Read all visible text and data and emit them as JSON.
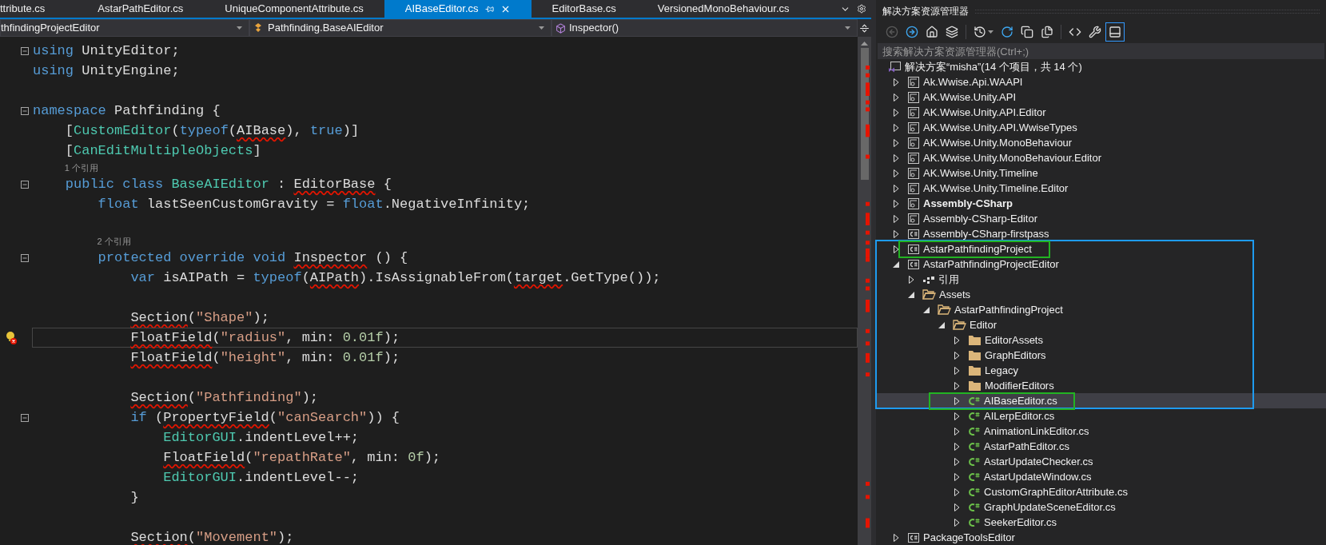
{
  "tabs": [
    {
      "label": "ttribute.cs",
      "selected": false
    },
    {
      "label": "AstarPathEditor.cs",
      "selected": false
    },
    {
      "label": "UniqueComponentAttribute.cs",
      "selected": false
    },
    {
      "label": "AIBaseEditor.cs",
      "selected": true
    },
    {
      "label": "EditorBase.cs",
      "selected": false
    },
    {
      "label": "VersionedMonoBehaviour.cs",
      "selected": false
    }
  ],
  "nav": {
    "project": "thfindingProjectEditor",
    "type": "Pathfinding.BaseAIEditor",
    "member": "Inspector()"
  },
  "editor": {
    "lines": [
      {
        "kind": "code",
        "fold": true,
        "current": false,
        "tokens": [
          {
            "text": "using",
            "kind": "kw"
          },
          {
            "text": " UnityEditor;",
            "kind": "txt"
          }
        ]
      },
      {
        "kind": "code",
        "fold": false,
        "current": false,
        "tokens": [
          {
            "text": "using",
            "kind": "kw"
          },
          {
            "text": " UnityEngine;",
            "kind": "txt"
          }
        ]
      },
      {
        "kind": "blank"
      },
      {
        "kind": "code",
        "fold": true,
        "current": false,
        "tokens": [
          {
            "text": "namespace",
            "kind": "kw"
          },
          {
            "text": " Pathfinding {",
            "kind": "txt"
          }
        ],
        "children": [
          {
            "kind": "code",
            "fold": false,
            "current": false,
            "tokens": [
              {
                "text": "[",
                "kind": "txt"
              },
              {
                "text": "CustomEditor",
                "kind": "type"
              },
              {
                "text": "(",
                "kind": "txt"
              },
              {
                "text": "typeof",
                "kind": "kw"
              },
              {
                "text": "(",
                "kind": "txt"
              },
              {
                "text": "AIBase",
                "kind": "err"
              },
              {
                "text": "), ",
                "kind": "txt"
              },
              {
                "text": "true",
                "kind": "kw"
              },
              {
                "text": ")]",
                "kind": "txt"
              }
            ]
          },
          {
            "kind": "code",
            "fold": false,
            "current": false,
            "tokens": [
              {
                "text": "[",
                "kind": "txt"
              },
              {
                "text": "CanEditMultipleObjects",
                "kind": "type"
              },
              {
                "text": "]",
                "kind": "txt"
              }
            ]
          },
          {
            "kind": "lens",
            "text": "1 个引用"
          },
          {
            "kind": "code",
            "fold": true,
            "current": false,
            "tokens": [
              {
                "text": "public class",
                "kind": "kw"
              },
              {
                "text": " BaseAIEditor",
                "kind": "type"
              },
              {
                "text": " : ",
                "kind": "txt"
              },
              {
                "text": "EditorBase",
                "kind": "err"
              },
              {
                "text": " {",
                "kind": "txt"
              }
            ],
            "children": [
              {
                "kind": "code",
                "fold": false,
                "current": false,
                "tokens": [
                  {
                    "text": "float",
                    "kind": "kw"
                  },
                  {
                    "text": " lastSeenCustomGravity = ",
                    "kind": "txt"
                  },
                  {
                    "text": "float",
                    "kind": "kw"
                  },
                  {
                    "text": ".NegativeInfinity;",
                    "kind": "txt"
                  }
                ]
              },
              {
                "kind": "blank"
              },
              {
                "kind": "lens",
                "text": "2 个引用"
              },
              {
                "kind": "code",
                "fold": true,
                "current": false,
                "tokens": [
                  {
                    "text": "protected override void ",
                    "kind": "kw"
                  },
                  {
                    "text": "Inspector",
                    "kind": "err"
                  },
                  {
                    "text": " () {",
                    "kind": "txt"
                  }
                ],
                "children": [
                  {
                    "kind": "code",
                    "fold": false,
                    "current": false,
                    "tokens": [
                      {
                        "text": "var",
                        "kind": "kw"
                      },
                      {
                        "text": " isAIPath = ",
                        "kind": "txt"
                      },
                      {
                        "text": "typeof",
                        "kind": "kw"
                      },
                      {
                        "text": "(",
                        "kind": "txt"
                      },
                      {
                        "text": "AIPath",
                        "kind": "err"
                      },
                      {
                        "text": ").IsAssignableFrom(",
                        "kind": "txt"
                      },
                      {
                        "text": "target",
                        "kind": "err"
                      },
                      {
                        "text": ".GetType());",
                        "kind": "txt"
                      }
                    ]
                  },
                  {
                    "kind": "blank"
                  },
                  {
                    "kind": "code",
                    "fold": false,
                    "current": false,
                    "tokens": [
                      {
                        "text": "Section",
                        "kind": "err"
                      },
                      {
                        "text": "(",
                        "kind": "txt"
                      },
                      {
                        "text": "\"Shape\"",
                        "kind": "str"
                      },
                      {
                        "text": ");",
                        "kind": "txt"
                      }
                    ]
                  },
                  {
                    "kind": "code",
                    "fold": false,
                    "current": true,
                    "lightbulb": true,
                    "tokens": [
                      {
                        "text": "FloatField",
                        "kind": "err"
                      },
                      {
                        "text": "(",
                        "kind": "txt"
                      },
                      {
                        "text": "\"radius\"",
                        "kind": "str"
                      },
                      {
                        "text": ", min: ",
                        "kind": "txt"
                      },
                      {
                        "text": "0.01f",
                        "kind": "num"
                      },
                      {
                        "text": ");",
                        "kind": "txt"
                      }
                    ]
                  },
                  {
                    "kind": "code",
                    "fold": false,
                    "current": false,
                    "tokens": [
                      {
                        "text": "FloatField",
                        "kind": "err"
                      },
                      {
                        "text": "(",
                        "kind": "txt"
                      },
                      {
                        "text": "\"height\"",
                        "kind": "str"
                      },
                      {
                        "text": ", min: ",
                        "kind": "txt"
                      },
                      {
                        "text": "0.01f",
                        "kind": "num"
                      },
                      {
                        "text": ");",
                        "kind": "txt"
                      }
                    ]
                  },
                  {
                    "kind": "blank"
                  },
                  {
                    "kind": "code",
                    "fold": false,
                    "current": false,
                    "tokens": [
                      {
                        "text": "Section",
                        "kind": "err"
                      },
                      {
                        "text": "(",
                        "kind": "txt"
                      },
                      {
                        "text": "\"Pathfinding\"",
                        "kind": "str"
                      },
                      {
                        "text": ");",
                        "kind": "txt"
                      }
                    ]
                  },
                  {
                    "kind": "code",
                    "fold": true,
                    "current": false,
                    "tokens": [
                      {
                        "text": "if",
                        "kind": "kw"
                      },
                      {
                        "text": " (",
                        "kind": "txt"
                      },
                      {
                        "text": "PropertyField",
                        "kind": "err"
                      },
                      {
                        "text": "(",
                        "kind": "txt"
                      },
                      {
                        "text": "\"canSearch\"",
                        "kind": "str"
                      },
                      {
                        "text": ")) {",
                        "kind": "txt"
                      }
                    ],
                    "children": [
                      {
                        "kind": "code",
                        "fold": false,
                        "current": false,
                        "tokens": [
                          {
                            "text": "EditorGUI",
                            "kind": "type"
                          },
                          {
                            "text": ".indentLevel++;",
                            "kind": "txt"
                          }
                        ]
                      },
                      {
                        "kind": "code",
                        "fold": false,
                        "current": false,
                        "tokens": [
                          {
                            "text": "FloatField",
                            "kind": "err"
                          },
                          {
                            "text": "(",
                            "kind": "txt"
                          },
                          {
                            "text": "\"repathRate\"",
                            "kind": "str"
                          },
                          {
                            "text": ", min: ",
                            "kind": "txt"
                          },
                          {
                            "text": "0f",
                            "kind": "num"
                          },
                          {
                            "text": ");",
                            "kind": "txt"
                          }
                        ]
                      },
                      {
                        "kind": "code",
                        "fold": false,
                        "current": false,
                        "tokens": [
                          {
                            "text": "EditorGUI",
                            "kind": "type"
                          },
                          {
                            "text": ".indentLevel--;",
                            "kind": "txt"
                          }
                        ]
                      }
                    ]
                  },
                  {
                    "kind": "code",
                    "fold": false,
                    "current": false,
                    "tokens": [
                      {
                        "text": "}",
                        "kind": "txt"
                      }
                    ]
                  },
                  {
                    "kind": "blank"
                  },
                  {
                    "kind": "code",
                    "fold": false,
                    "current": false,
                    "tokens": [
                      {
                        "text": "Section",
                        "kind": "err"
                      },
                      {
                        "text": "(",
                        "kind": "txt"
                      },
                      {
                        "text": "\"Movement\"",
                        "kind": "str"
                      },
                      {
                        "text": ");",
                        "kind": "txt"
                      }
                    ]
                  }
                ]
              }
            ]
          }
        ]
      }
    ]
  },
  "explorer": {
    "title": "解决方案资源管理器",
    "toolbar": [
      [
        {
          "kind": "back",
          "disabled": true,
          "pressed": false
        },
        {
          "kind": "forward",
          "disabled": false,
          "pressed": false
        },
        {
          "kind": "home",
          "disabled": false,
          "pressed": false
        },
        {
          "kind": "switch_views",
          "disabled": false,
          "pressed": false
        }
      ],
      [
        {
          "kind": "history",
          "disabled": false,
          "pressed": false
        },
        {
          "kind": "refresh",
          "disabled": false,
          "pressed": false
        },
        {
          "kind": "collapse_all",
          "disabled": false,
          "pressed": false
        },
        {
          "kind": "show_all_files",
          "disabled": false,
          "pressed": false
        }
      ],
      [
        {
          "kind": "view_code",
          "disabled": false,
          "pressed": false
        },
        {
          "kind": "properties",
          "disabled": false,
          "pressed": false
        },
        {
          "kind": "preview",
          "disabled": false,
          "pressed": true
        }
      ]
    ],
    "search": {
      "placeholder": "搜索解决方案资源管理器(Ctrl+;)"
    },
    "solution": {
      "label": "解决方案“misha”(14 个项目，共 14 个)",
      "items": [
        {
          "label": "Ak.Wwise.Api.WAAPI",
          "kind": "project",
          "startup": false,
          "expanded": false,
          "selected": false
        },
        {
          "label": "AK.Wwise.Unity.API",
          "kind": "project",
          "startup": false,
          "expanded": false,
          "selected": false
        },
        {
          "label": "AK.Wwise.Unity.API.Editor",
          "kind": "project",
          "startup": false,
          "expanded": false,
          "selected": false
        },
        {
          "label": "AK.Wwise.Unity.API.WwiseTypes",
          "kind": "project",
          "startup": false,
          "expanded": false,
          "selected": false
        },
        {
          "label": "AK.Wwise.Unity.MonoBehaviour",
          "kind": "project",
          "startup": false,
          "expanded": false,
          "selected": false
        },
        {
          "label": "AK.Wwise.Unity.MonoBehaviour.Editor",
          "kind": "project",
          "startup": false,
          "expanded": false,
          "selected": false
        },
        {
          "label": "AK.Wwise.Unity.Timeline",
          "kind": "project",
          "startup": false,
          "expanded": false,
          "selected": false
        },
        {
          "label": "AK.Wwise.Unity.Timeline.Editor",
          "kind": "project",
          "startup": false,
          "expanded": false,
          "selected": false
        },
        {
          "label": "Assembly-CSharp",
          "kind": "project",
          "startup": true,
          "expanded": false,
          "selected": false
        },
        {
          "label": "Assembly-CSharp-Editor",
          "kind": "project",
          "startup": false,
          "expanded": false,
          "selected": false
        },
        {
          "label": "Assembly-CSharp-firstpass",
          "kind": "csproject",
          "startup": false,
          "expanded": false,
          "selected": false
        },
        {
          "label": "AstarPathfindingProject",
          "kind": "csproject",
          "startup": false,
          "expanded": false,
          "selected": false
        },
        {
          "label": "AstarPathfindingProjectEditor",
          "kind": "csproject",
          "startup": false,
          "expanded": true,
          "selected": false,
          "children": [
            {
              "label": "引用",
              "kind": "references",
              "expanded": false,
              "selected": false
            },
            {
              "label": "Assets",
              "kind": "folder",
              "expanded": true,
              "selected": false,
              "children": [
                {
                  "label": "AstarPathfindingProject",
                  "kind": "folder",
                  "expanded": true,
                  "selected": false,
                  "children": [
                    {
                      "label": "Editor",
                      "kind": "folder",
                      "expanded": true,
                      "selected": false,
                      "children": [
                        {
                          "label": "EditorAssets",
                          "kind": "folder",
                          "expanded": false,
                          "selected": false
                        },
                        {
                          "label": "GraphEditors",
                          "kind": "folder",
                          "expanded": false,
                          "selected": false
                        },
                        {
                          "label": "Legacy",
                          "kind": "folder",
                          "expanded": false,
                          "selected": false
                        },
                        {
                          "label": "ModifierEditors",
                          "kind": "folder",
                          "expanded": false,
                          "selected": false
                        },
                        {
                          "label": "AIBaseEditor.cs",
                          "kind": "file",
                          "expanded": false,
                          "selected": true
                        },
                        {
                          "label": "AILerpEditor.cs",
                          "kind": "file",
                          "expanded": false,
                          "selected": false
                        },
                        {
                          "label": "AnimationLinkEditor.cs",
                          "kind": "file",
                          "expanded": false,
                          "selected": false
                        },
                        {
                          "label": "AstarPathEditor.cs",
                          "kind": "file",
                          "expanded": false,
                          "selected": false
                        },
                        {
                          "label": "AstarUpdateChecker.cs",
                          "kind": "file",
                          "expanded": false,
                          "selected": false
                        },
                        {
                          "label": "AstarUpdateWindow.cs",
                          "kind": "file",
                          "expanded": false,
                          "selected": false
                        },
                        {
                          "label": "CustomGraphEditorAttribute.cs",
                          "kind": "file",
                          "expanded": false,
                          "selected": false
                        },
                        {
                          "label": "GraphUpdateSceneEditor.cs",
                          "kind": "file",
                          "expanded": false,
                          "selected": false
                        },
                        {
                          "label": "SeekerEditor.cs",
                          "kind": "file",
                          "expanded": false,
                          "selected": false
                        }
                      ]
                    }
                  ]
                }
              ]
            }
          ]
        },
        {
          "label": "PackageToolsEditor",
          "kind": "csproject",
          "startup": false,
          "expanded": false,
          "selected": false
        }
      ]
    }
  }
}
